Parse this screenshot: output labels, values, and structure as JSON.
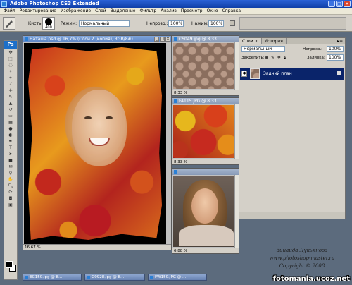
{
  "app": {
    "title": "Adobe Photoshop CS3 Extended",
    "window_buttons": [
      "_",
      "□",
      "×"
    ]
  },
  "menu": [
    "Файл",
    "Редактирование",
    "Изображение",
    "Слой",
    "Выделение",
    "Фильтр",
    "Анализ",
    "Просмотр",
    "Окно",
    "Справка"
  ],
  "options": {
    "brush_label": "Кисть:",
    "brush_size": "400",
    "mode_label": "Режим:",
    "mode_value": "Нормальный",
    "opacity_label": "Непрозр.:",
    "opacity_value": "100%",
    "flow_label": "Нажим:",
    "flow_value": "100%"
  },
  "documents": [
    {
      "title": "Наташа.psd @ 16,7% (Слой 2 (копия), RGB/8#)",
      "zoom": "16,67 %",
      "content": "leaf-portrait"
    },
    {
      "title": "CS049.jpg @ 8,33...",
      "zoom": "8,33 %",
      "content": "damask"
    },
    {
      "title": "FA115.JPG @ 8,33...",
      "zoom": "8,33 %",
      "content": "leaves"
    },
    {
      "title": "",
      "zoom": "6,88 %",
      "content": "portrait"
    }
  ],
  "layers_panel": {
    "tabs": [
      "Слои ×",
      "История"
    ],
    "blend_mode": "Нормальный",
    "opacity_label": "Непрозр.:",
    "opacity_value": "100%",
    "lock_label": "Закрепить:",
    "fill_label": "Заливка:",
    "fill_value": "100%",
    "layer_name": "Задний план"
  },
  "taskbar_docs": [
    "EG150.jpg @ 8...",
    "G0928.jpg @ 8...",
    "FW150.JPG @ ..."
  ],
  "signature": {
    "line1": "Зинаида Лукьянова",
    "line2": "www.photoshop-master.ru",
    "line3": "Copyright © 2008"
  },
  "watermark": "fotomania.ucoz.net",
  "tools": [
    "move-icon",
    "marquee-icon",
    "lasso-icon",
    "magic-wand-icon",
    "crop-icon",
    "slice-icon",
    "healing-icon",
    "brush-icon",
    "stamp-icon",
    "history-brush-icon",
    "eraser-icon",
    "gradient-icon",
    "blur-icon",
    "dodge-icon",
    "pen-icon",
    "type-icon",
    "path-select-icon",
    "shape-icon",
    "notes-icon",
    "eyedropper-icon",
    "hand-icon",
    "zoom-icon"
  ],
  "colors": {
    "foreground": "#000000",
    "background": "#ffffff",
    "accent": "#0a246a"
  }
}
